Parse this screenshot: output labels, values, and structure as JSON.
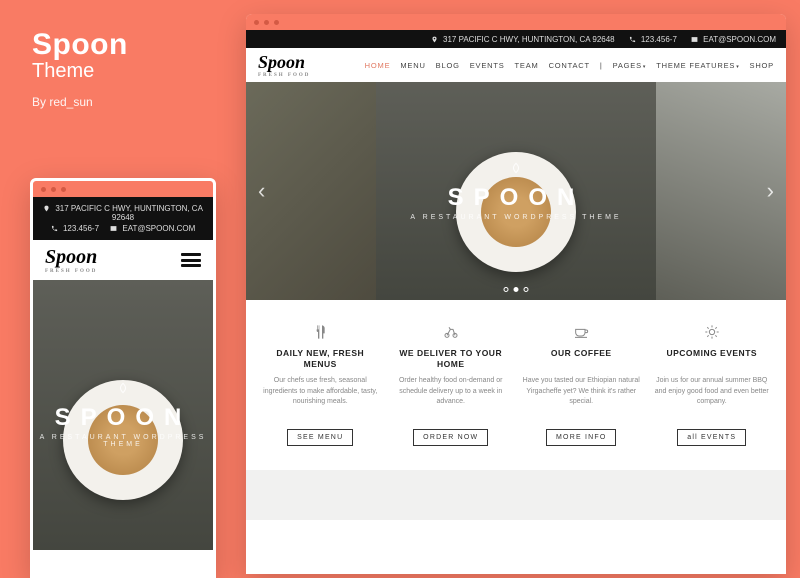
{
  "promo": {
    "title": "Spoon",
    "subtitle": "Theme",
    "byline": "By red_sun"
  },
  "topbar": {
    "address": "317 PACIFIC C HWY, HUNTINGTON, CA 92648",
    "phone": "123.456-7",
    "email": "EAT@SPOON.COM"
  },
  "logo": {
    "text": "Spoon",
    "tag": "FRESH FOOD"
  },
  "nav": {
    "items": [
      {
        "label": "HOME",
        "active": true
      },
      {
        "label": "MENU"
      },
      {
        "label": "BLOG"
      },
      {
        "label": "EVENTS"
      },
      {
        "label": "TEAM"
      },
      {
        "label": "CONTACT"
      },
      {
        "label": "|"
      },
      {
        "label": "PAGES",
        "dropdown": true
      },
      {
        "label": "THEME FEATURES",
        "dropdown": true
      },
      {
        "label": "SHOP"
      }
    ]
  },
  "hero": {
    "title": "SPOON",
    "tagline": "A RESTAURANT WORDPRESS THEME",
    "slide_index": 1,
    "slide_count": 3
  },
  "cards": [
    {
      "icon": "utensils-icon",
      "title": "DAILY NEW, FRESH MENUS",
      "body": "Our chefs use fresh, seasonal ingredients to make affordable, tasty, nourishing meals.",
      "cta": "SEE MENU"
    },
    {
      "icon": "bike-icon",
      "title": "WE DELIVER TO YOUR HOME",
      "body": "Order healthy food on-demand or schedule delivery up to a week in advance.",
      "cta": "ORDER NOW"
    },
    {
      "icon": "cup-icon",
      "title": "OUR COFFEE",
      "body": "Have you tasted our Ethiopian natural Yirgacheffe yet? We think it's rather special.",
      "cta": "MORE INFO"
    },
    {
      "icon": "sun-icon",
      "title": "UPCOMING EVENTS",
      "body": "Join us for our annual summer BBQ and enjoy good food and even better company.",
      "cta": "all EVENTS"
    }
  ],
  "mobile_topbar": {
    "address": "317 PACIFIC C HWY, HUNTINGTON, CA 92648",
    "phone": "123.456-7",
    "email": "EAT@SPOON.COM"
  }
}
